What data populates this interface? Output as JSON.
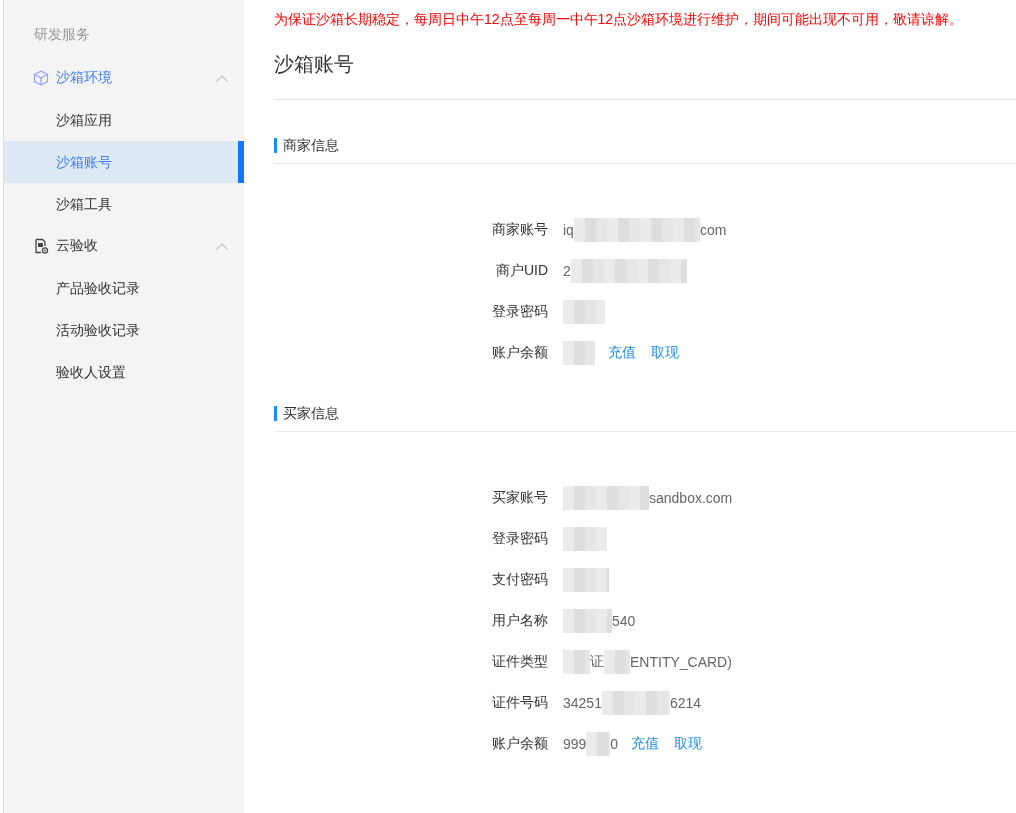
{
  "sidebar": {
    "heading": "研发服务",
    "groups": [
      {
        "label": "沙箱环境",
        "active": true,
        "expanded": true,
        "children": [
          {
            "label": "沙箱应用",
            "selected": false
          },
          {
            "label": "沙箱账号",
            "selected": true
          },
          {
            "label": "沙箱工具",
            "selected": false
          }
        ]
      },
      {
        "label": "云验收",
        "active": false,
        "expanded": true,
        "children": [
          {
            "label": "产品验收记录",
            "selected": false
          },
          {
            "label": "活动验收记录",
            "selected": false
          },
          {
            "label": "验收人设置",
            "selected": false
          }
        ]
      }
    ]
  },
  "notice": "为保证沙箱长期稳定，每周日中午12点至每周一中午12点沙箱环境进行维护，期间可能出现不可用，敬请谅解。",
  "page_title": "沙箱账号",
  "sections": [
    {
      "title": "商家信息",
      "fields": [
        {
          "label": "商家账号",
          "value": [
            {
              "kind": "text",
              "text": "iq"
            },
            {
              "kind": "redacted"
            },
            {
              "kind": "text",
              "text": "com"
            }
          ]
        },
        {
          "label": "商户UID",
          "value": [
            {
              "kind": "text",
              "text": "2"
            },
            {
              "kind": "redacted"
            }
          ]
        },
        {
          "label": "登录密码",
          "value": [
            {
              "kind": "redacted"
            }
          ]
        },
        {
          "label": "账户余额",
          "value": [
            {
              "kind": "redacted"
            }
          ],
          "actions": [
            "充值",
            "取现"
          ]
        }
      ]
    },
    {
      "title": "买家信息",
      "fields": [
        {
          "label": "买家账号",
          "value": [
            {
              "kind": "redacted"
            },
            {
              "kind": "text",
              "text": "sandbox.com"
            }
          ]
        },
        {
          "label": "登录密码",
          "value": [
            {
              "kind": "redacted"
            }
          ]
        },
        {
          "label": "支付密码",
          "value": [
            {
              "kind": "redacted"
            }
          ]
        },
        {
          "label": "用户名称",
          "value": [
            {
              "kind": "redacted"
            },
            {
              "kind": "text",
              "text": "540"
            }
          ]
        },
        {
          "label": "证件类型",
          "value": [
            {
              "kind": "redacted"
            },
            {
              "kind": "text",
              "text": "证"
            },
            {
              "kind": "redacted"
            },
            {
              "kind": "text",
              "text": "ENTITY_CARD)"
            }
          ]
        },
        {
          "label": "证件号码",
          "value": [
            {
              "kind": "text",
              "text": "34251"
            },
            {
              "kind": "redacted"
            },
            {
              "kind": "text",
              "text": "6214"
            }
          ]
        },
        {
          "label": "账户余额",
          "value": [
            {
              "kind": "text",
              "text": "999"
            },
            {
              "kind": "redacted"
            },
            {
              "kind": "text",
              "text": "0"
            }
          ],
          "actions": [
            "充值",
            "取现"
          ]
        }
      ]
    }
  ]
}
